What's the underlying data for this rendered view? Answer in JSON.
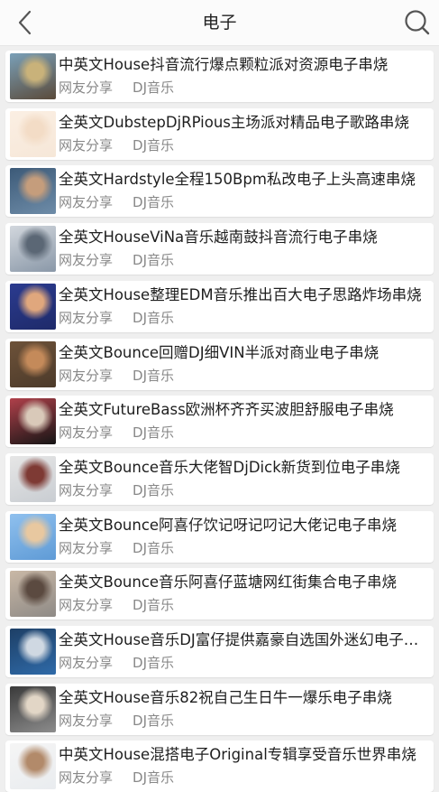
{
  "header": {
    "title": "电子",
    "back_icon": "chevron-left-icon",
    "search_icon": "search-icon"
  },
  "items": [
    {
      "title": "中英文House抖音流行爆点颗粒派对资源电子串烧",
      "uploader": "网友分享",
      "source": "DJ音乐",
      "thumb_colors": [
        "#5a4a3a",
        "#c9b27a",
        "#7aa0b8"
      ]
    },
    {
      "title": "全英文DubstepDjRPious主场派对精品电子歌路串烧",
      "uploader": "网友分享",
      "source": "DJ音乐",
      "thumb_colors": [
        "#f6e7d8",
        "#f3dcc6",
        "#fbefe3"
      ]
    },
    {
      "title": "全英文Hardstyle全程150Bpm私改电子上头高速串烧",
      "uploader": "网友分享",
      "source": "DJ音乐",
      "thumb_colors": [
        "#6e8ca8",
        "#c59d7c",
        "#3c5a78"
      ]
    },
    {
      "title": "全英文HouseViNa音乐越南鼓抖音流行电子串烧",
      "uploader": "网友分享",
      "source": "DJ音乐",
      "thumb_colors": [
        "#8a98a8",
        "#5b6775",
        "#d2d7dd"
      ]
    },
    {
      "title": "全英文House整理EDM音乐推出百大电子思路炸场串烧",
      "uploader": "网友分享",
      "source": "DJ音乐",
      "thumb_colors": [
        "#1e2a6a",
        "#e0a77d",
        "#2b3b8f"
      ]
    },
    {
      "title": "全英文Bounce回赠DJ细VIN半派对商业电子串烧",
      "uploader": "网友分享",
      "source": "DJ音乐",
      "thumb_colors": [
        "#4c3a2a",
        "#c48a5a",
        "#6d5239"
      ]
    },
    {
      "title": "全英文FutureBass欧洲杯齐齐买波胆舒服电子串烧",
      "uploader": "网友分享",
      "source": "DJ音乐",
      "thumb_colors": [
        "#151515",
        "#d9c9b9",
        "#b0404a"
      ]
    },
    {
      "title": "全英文Bounce音乐大佬智DjDick新货到位电子串烧",
      "uploader": "网友分享",
      "source": "DJ音乐",
      "thumb_colors": [
        "#c9cdd2",
        "#7e3a34",
        "#e6e6e6"
      ]
    },
    {
      "title": "全英文Bounce阿喜仔饮记呀记叼记大佬记电子串烧",
      "uploader": "网友分享",
      "source": "DJ音乐",
      "thumb_colors": [
        "#5f9bd6",
        "#e8c8a0",
        "#8fc0ee"
      ]
    },
    {
      "title": "全英文Bounce音乐阿喜仔蓝塘网红街集合电子串烧",
      "uploader": "网友分享",
      "source": "DJ音乐",
      "thumb_colors": [
        "#8e8a86",
        "#5b4a40",
        "#c9b8a6"
      ]
    },
    {
      "title": "全英文House音乐DJ富仔提供嘉豪自选国外迷幻电子串烧",
      "uploader": "网友分享",
      "source": "DJ音乐",
      "thumb_colors": [
        "#2f6aa8",
        "#cfd8e2",
        "#1d3f66"
      ]
    },
    {
      "title": "全英文House音乐82祝自己生日牛一爆乐电子串烧",
      "uploader": "网友分享",
      "source": "DJ音乐",
      "thumb_colors": [
        "#8c8c8c",
        "#e2d6c6",
        "#3a3a3a"
      ]
    },
    {
      "title": "中英文House混搭电子Original专辑享受音乐世界串烧",
      "uploader": "网友分享",
      "source": "DJ音乐",
      "thumb_colors": [
        "#e9ecef",
        "#b28a6a",
        "#f5f5f5"
      ]
    }
  ]
}
